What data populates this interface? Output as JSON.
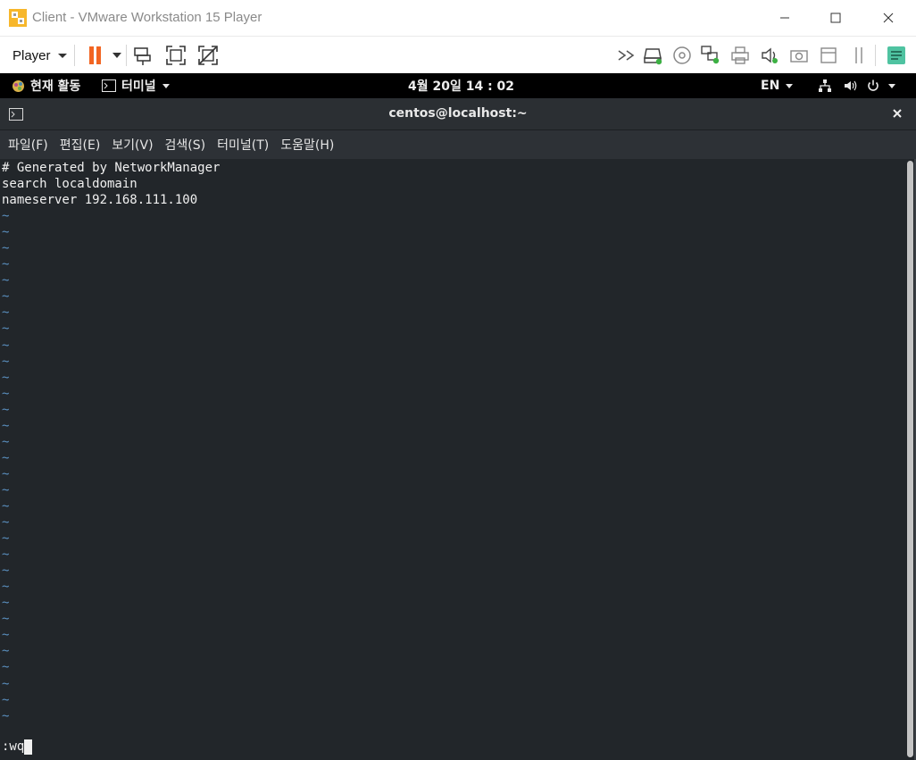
{
  "window": {
    "title": "Client - VMware Workstation 15 Player"
  },
  "toolbar": {
    "player_label": "Player",
    "accent_color": "#f26522"
  },
  "gnome_bar": {
    "activities": "현재 활동",
    "app_menu": "터미널",
    "clock": "4월 20일  14 : 02",
    "language": "EN"
  },
  "terminal": {
    "title": "centos@localhost:~",
    "menu": [
      "파일(F)",
      "편집(E)",
      "보기(V)",
      "검색(S)",
      "터미널(T)",
      "도움말(H)"
    ],
    "lines": [
      "# Generated by NetworkManager",
      "search localdomain",
      "nameserver 192.168.111.100"
    ],
    "empty_line_marker": "~",
    "command": ":wq"
  },
  "icons": {
    "titlebar": [
      "vmware-logo-icon",
      "minimize-icon",
      "maximize-icon",
      "close-icon"
    ],
    "toolbar": [
      "pause-icon",
      "send-ctrl-alt-del-icon",
      "fullscreen-icon",
      "unity-icon",
      "forward-icon",
      "hard-disk-icon",
      "cd-dvd-icon",
      "network-adapter-icon",
      "printer-icon",
      "sound-icon",
      "camera-icon",
      "floppy-icon",
      "usb-icon",
      "message-log-icon"
    ]
  }
}
